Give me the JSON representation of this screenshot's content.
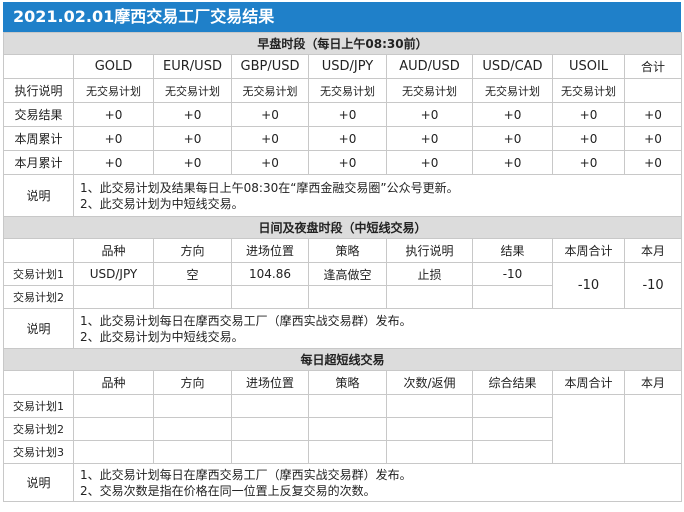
{
  "header": {
    "title": "2021.02.01摩西交易工厂交易结果"
  },
  "morning": {
    "title": "早盘时段（每日上午08:30前）",
    "columns": [
      "GOLD",
      "EUR/USD",
      "GBP/USD",
      "USD/JPY",
      "AUD/USD",
      "USD/CAD",
      "USOIL",
      "合计"
    ],
    "rows": [
      {
        "label": "执行说明",
        "cells": [
          "无交易计划",
          "无交易计划",
          "无交易计划",
          "无交易计划",
          "无交易计划",
          "无交易计划",
          "无交易计划",
          ""
        ]
      },
      {
        "label": "交易结果",
        "cells": [
          "+0",
          "+0",
          "+0",
          "+0",
          "+0",
          "+0",
          "+0",
          "+0"
        ]
      },
      {
        "label": "本周累计",
        "cells": [
          "+0",
          "+0",
          "+0",
          "+0",
          "+0",
          "+0",
          "+0",
          "+0"
        ]
      },
      {
        "label": "本月累计",
        "cells": [
          "+0",
          "+0",
          "+0",
          "+0",
          "+0",
          "+0",
          "+0",
          "+0"
        ]
      }
    ],
    "note_label": "说明",
    "notes": [
      "1、此交易计划及结果每日上午08:30在“摩西金融交易圈”公众号更新。",
      "2、此交易计划为中短线交易。"
    ]
  },
  "day": {
    "title": "日间及夜盘时段（中短线交易）",
    "columns": [
      "品种",
      "方向",
      "进场位置",
      "策略",
      "执行说明",
      "结果",
      "本周合计",
      "本月"
    ],
    "plans": [
      {
        "label": "交易计划1",
        "cells": [
          "USD/JPY",
          "空",
          "104.86",
          "逢高做空",
          "止损",
          "-10"
        ]
      },
      {
        "label": "交易计划2",
        "cells": [
          "",
          "",
          "",
          "",
          "",
          ""
        ]
      }
    ],
    "week_total": "-10",
    "month_total": "-10",
    "note_label": "说明",
    "notes": [
      "1、此交易计划每日在摩西交易工厂（摩西实战交易群）发布。",
      "2、此交易计划为中短线交易。"
    ]
  },
  "scalp": {
    "title": "每日超短线交易",
    "columns": [
      "品种",
      "方向",
      "进场位置",
      "策略",
      "次数/返佣",
      "综合结果",
      "本周合计",
      "本月"
    ],
    "plans": [
      {
        "label": "交易计划1",
        "cells": [
          "",
          "",
          "",
          "",
          "",
          ""
        ]
      },
      {
        "label": "交易计划2",
        "cells": [
          "",
          "",
          "",
          "",
          "",
          ""
        ]
      },
      {
        "label": "交易计划3",
        "cells": [
          "",
          "",
          "",
          "",
          "",
          ""
        ]
      }
    ],
    "week_total": "",
    "month_total": "",
    "note_label": "说明",
    "notes": [
      "1、此交易计划每日在摩西交易工厂（摩西实战交易群）发布。",
      "2、交易次数是指在价格在同一位置上反复交易的次数。"
    ]
  }
}
